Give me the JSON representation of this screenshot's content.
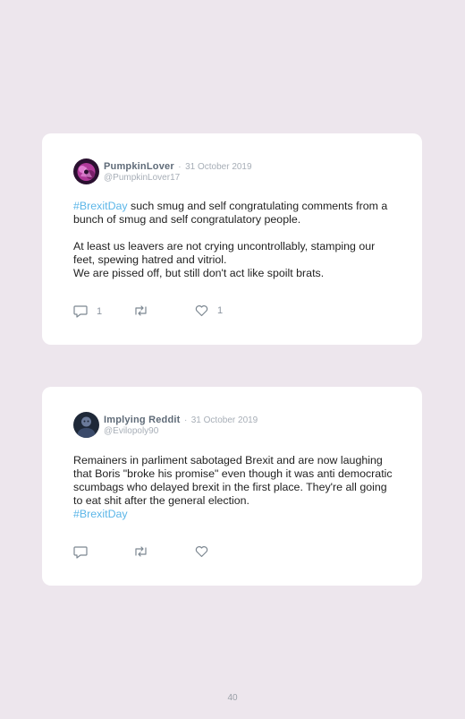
{
  "tweets": [
    {
      "name": "PumpkinLover",
      "separator": "·",
      "date": "31 October 2019",
      "handle": "@PumpkinLover17",
      "hashtag": "#BrexitDay",
      "text_after_hashtag": " such smug and self congratulating comments from a bunch of smug and self congratulatory people.",
      "paragraph2": "At least us leavers are not crying uncontrollably, stamping our feet, spewing hatred and vitriol.",
      "paragraph3": "We are pissed off, but still don't act like spoilt brats.",
      "reply_count": "1",
      "like_count": "1",
      "avatar_icon": "pumpkin-avatar-icon",
      "avatar_color": "#b03a9a"
    },
    {
      "name": "Implying Reddit",
      "separator": "·",
      "date": "31 October 2019",
      "handle": "@Evilopoly90",
      "text": "Remainers in parliment sabotaged Brexit and are now laughing that Boris \"broke his promise\" even though it was anti democratic scumbags who delayed brexit in the first place. They're all going to eat shit after the general election.",
      "hashtag": "#BrexitDay",
      "avatar_icon": "person-avatar-icon",
      "avatar_color": "#3a4a6a"
    }
  ],
  "page_number": "40",
  "colors": {
    "background": "#ede6ed",
    "card": "#ffffff",
    "hashtag": "#5cb6e8",
    "meta": "#a7aeb7"
  }
}
